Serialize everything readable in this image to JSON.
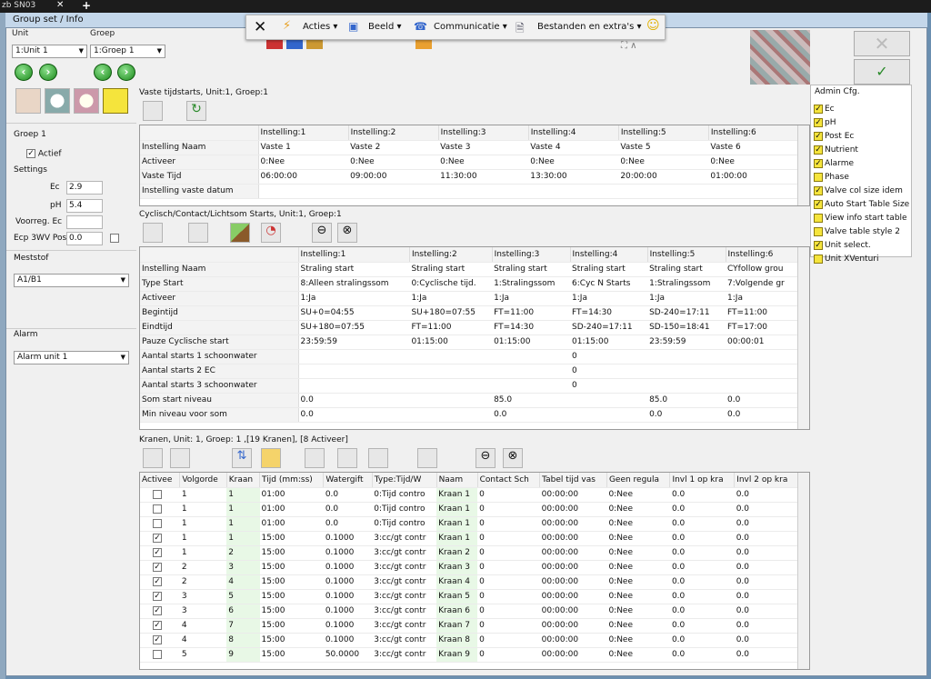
{
  "topbar": {
    "tab_title": "zb SN03"
  },
  "window_title": "Group set / Info",
  "left": {
    "unit_label": "Unit",
    "group_label": "Groep",
    "unit_value": "1:Unit 1",
    "group_value": "1:Groep 1",
    "group_name": "Groep 1",
    "actief_label": "Actief",
    "settings_label": "Settings",
    "ec_label": "Ec",
    "ec_value": "2.9",
    "ph_label": "pH",
    "ph_value": "5.4",
    "voorreg_label": "Voorreg. Ec",
    "voorreg_value": "",
    "ecp_label": "Ecp 3WV Pos",
    "ecp_value": "0.0",
    "meststof_label": "Meststof",
    "meststof_value": "A1/B1",
    "alarm_label": "Alarm",
    "alarm_value": "Alarm unit 1"
  },
  "floatbar": {
    "acties": "Acties",
    "beeld": "Beeld",
    "communicatie": "Communicatie",
    "bestanden": "Bestanden en extra's"
  },
  "vaste": {
    "title": "Vaste tijdstarts, Unit:1, Groep:1",
    "headers": [
      "Instelling:1",
      "Instelling:2",
      "Instelling:3",
      "Instelling:4",
      "Instelling:5",
      "Instelling:6"
    ],
    "rows": [
      {
        "label": "Instelling Naam",
        "cells": [
          "Vaste 1",
          "Vaste 2",
          "Vaste 3",
          "Vaste 4",
          "Vaste 5",
          "Vaste 6"
        ]
      },
      {
        "label": "Activeer",
        "cells": [
          "0:Nee",
          "0:Nee",
          "0:Nee",
          "0:Nee",
          "0:Nee",
          "0:Nee"
        ]
      },
      {
        "label": "Vaste Tijd",
        "cells": [
          "06:00:00",
          "09:00:00",
          "11:30:00",
          "13:30:00",
          "20:00:00",
          "01:00:00"
        ]
      },
      {
        "label": "Instelling vaste datum",
        "cells": [
          "",
          "",
          "",
          "",
          "",
          ""
        ]
      }
    ]
  },
  "cyclisch": {
    "title": "Cyclisch/Contact/Lichtsom Starts, Unit:1, Groep:1",
    "headers": [
      "Instelling:1",
      "Instelling:2",
      "Instelling:3",
      "Instelling:4",
      "Instelling:5",
      "Instelling:6"
    ],
    "rows": [
      {
        "label": "Instelling Naam",
        "cells": [
          "Straling start",
          "Straling start",
          "Straling start",
          "Straling start",
          "Straling start",
          "CYfollow grou"
        ]
      },
      {
        "label": "Type Start",
        "cells": [
          "8:Alleen stralingssom",
          "0:Cyclische tijd.",
          "1:Stralingssom",
          "6:Cyc N Starts",
          "1:Stralingssom",
          "7:Volgende gr"
        ]
      },
      {
        "label": "Activeer",
        "cells": [
          "1:Ja",
          "1:Ja",
          "1:Ja",
          "1:Ja",
          "1:Ja",
          "1:Ja"
        ]
      },
      {
        "label": "Begintijd",
        "cells": [
          "SU+0=04:55",
          "SU+180=07:55",
          "FT=11:00",
          "FT=14:30",
          "SD-240=17:11",
          "FT=11:00"
        ]
      },
      {
        "label": "Eindtijd",
        "cells": [
          "SU+180=07:55",
          "FT=11:00",
          "FT=14:30",
          "SD-240=17:11",
          "SD-150=18:41",
          "FT=17:00"
        ]
      },
      {
        "label": "Pauze Cyclische start",
        "cells": [
          "23:59:59",
          "01:15:00",
          "01:15:00",
          "01:15:00",
          "23:59:59",
          "00:00:01"
        ]
      },
      {
        "label": "Aantal starts 1 schoonwater",
        "cells": [
          "",
          "",
          "",
          "0",
          "",
          ""
        ]
      },
      {
        "label": "Aantal starts 2 EC",
        "cells": [
          "",
          "",
          "",
          "0",
          "",
          ""
        ]
      },
      {
        "label": "Aantal starts 3 schoonwater",
        "cells": [
          "",
          "",
          "",
          "0",
          "",
          ""
        ]
      },
      {
        "label": "Som start niveau",
        "cells": [
          "0.0",
          "",
          "85.0",
          "",
          "85.0",
          "0.0"
        ]
      },
      {
        "label": "Min niveau voor som",
        "cells": [
          "0.0",
          "",
          "0.0",
          "",
          "0.0",
          "0.0"
        ]
      }
    ]
  },
  "kranen": {
    "title": "Kranen, Unit: 1, Groep: 1 ,[19 Kranen], [8 Activeer]",
    "headers": [
      "Activee",
      "Volgorde",
      "Kraan",
      "Tijd (mm:ss)",
      "Watergift",
      "Type:Tijd/W",
      "Naam",
      "Contact Sch",
      "Tabel tijd vas",
      "Geen regula",
      "Invl 1 op kra",
      "Invl 2 op kra"
    ],
    "rows": [
      {
        "on": false,
        "cells": [
          "1",
          "1",
          "01:00",
          "0.0",
          "0:Tijd contro",
          "Kraan 1",
          "0",
          "00:00:00",
          "0:Nee",
          "0.0",
          "0.0"
        ]
      },
      {
        "on": false,
        "cells": [
          "1",
          "1",
          "01:00",
          "0.0",
          "0:Tijd contro",
          "Kraan 1",
          "0",
          "00:00:00",
          "0:Nee",
          "0.0",
          "0.0"
        ]
      },
      {
        "on": false,
        "cells": [
          "1",
          "1",
          "01:00",
          "0.0",
          "0:Tijd contro",
          "Kraan 1",
          "0",
          "00:00:00",
          "0:Nee",
          "0.0",
          "0.0"
        ]
      },
      {
        "on": true,
        "cells": [
          "1",
          "1",
          "15:00",
          "0.1000",
          "3:cc/gt contr",
          "Kraan 1",
          "0",
          "00:00:00",
          "0:Nee",
          "0.0",
          "0.0"
        ]
      },
      {
        "on": true,
        "cells": [
          "1",
          "2",
          "15:00",
          "0.1000",
          "3:cc/gt contr",
          "Kraan 2",
          "0",
          "00:00:00",
          "0:Nee",
          "0.0",
          "0.0"
        ]
      },
      {
        "on": true,
        "cells": [
          "2",
          "3",
          "15:00",
          "0.1000",
          "3:cc/gt contr",
          "Kraan 3",
          "0",
          "00:00:00",
          "0:Nee",
          "0.0",
          "0.0"
        ]
      },
      {
        "on": true,
        "cells": [
          "2",
          "4",
          "15:00",
          "0.1000",
          "3:cc/gt contr",
          "Kraan 4",
          "0",
          "00:00:00",
          "0:Nee",
          "0.0",
          "0.0"
        ]
      },
      {
        "on": true,
        "cells": [
          "3",
          "5",
          "15:00",
          "0.1000",
          "3:cc/gt contr",
          "Kraan 5",
          "0",
          "00:00:00",
          "0:Nee",
          "0.0",
          "0.0"
        ]
      },
      {
        "on": true,
        "cells": [
          "3",
          "6",
          "15:00",
          "0.1000",
          "3:cc/gt contr",
          "Kraan 6",
          "0",
          "00:00:00",
          "0:Nee",
          "0.0",
          "0.0"
        ]
      },
      {
        "on": true,
        "cells": [
          "4",
          "7",
          "15:00",
          "0.1000",
          "3:cc/gt contr",
          "Kraan 7",
          "0",
          "00:00:00",
          "0:Nee",
          "0.0",
          "0.0"
        ]
      },
      {
        "on": true,
        "cells": [
          "4",
          "8",
          "15:00",
          "0.1000",
          "3:cc/gt contr",
          "Kraan 8",
          "0",
          "00:00:00",
          "0:Nee",
          "0.0",
          "0.0"
        ]
      },
      {
        "on": false,
        "cells": [
          "5",
          "9",
          "15:00",
          "50.0000",
          "3:cc/gt contr",
          "Kraan 9",
          "0",
          "00:00:00",
          "0:Nee",
          "0.0",
          "0.0"
        ]
      }
    ]
  },
  "admin": {
    "title": "Admin Cfg.",
    "items": [
      {
        "label": "Ec",
        "on": true
      },
      {
        "label": "pH",
        "on": true
      },
      {
        "label": "Post Ec",
        "on": true
      },
      {
        "label": "Nutrient",
        "on": true
      },
      {
        "label": "Alarme",
        "on": true
      },
      {
        "label": "Phase",
        "on": false
      },
      {
        "label": "Valve col size idem",
        "on": true
      },
      {
        "label": "Auto Start Table Size",
        "on": true
      },
      {
        "label": "View info start table",
        "on": false
      },
      {
        "label": "Valve table style 2",
        "on": false
      },
      {
        "label": "Unit select.",
        "on": true
      },
      {
        "label": "Unit XVenturi",
        "on": false
      }
    ]
  },
  "colors": {
    "accent_yellow": "#f5e43c",
    "green": "#1b8a1b"
  }
}
